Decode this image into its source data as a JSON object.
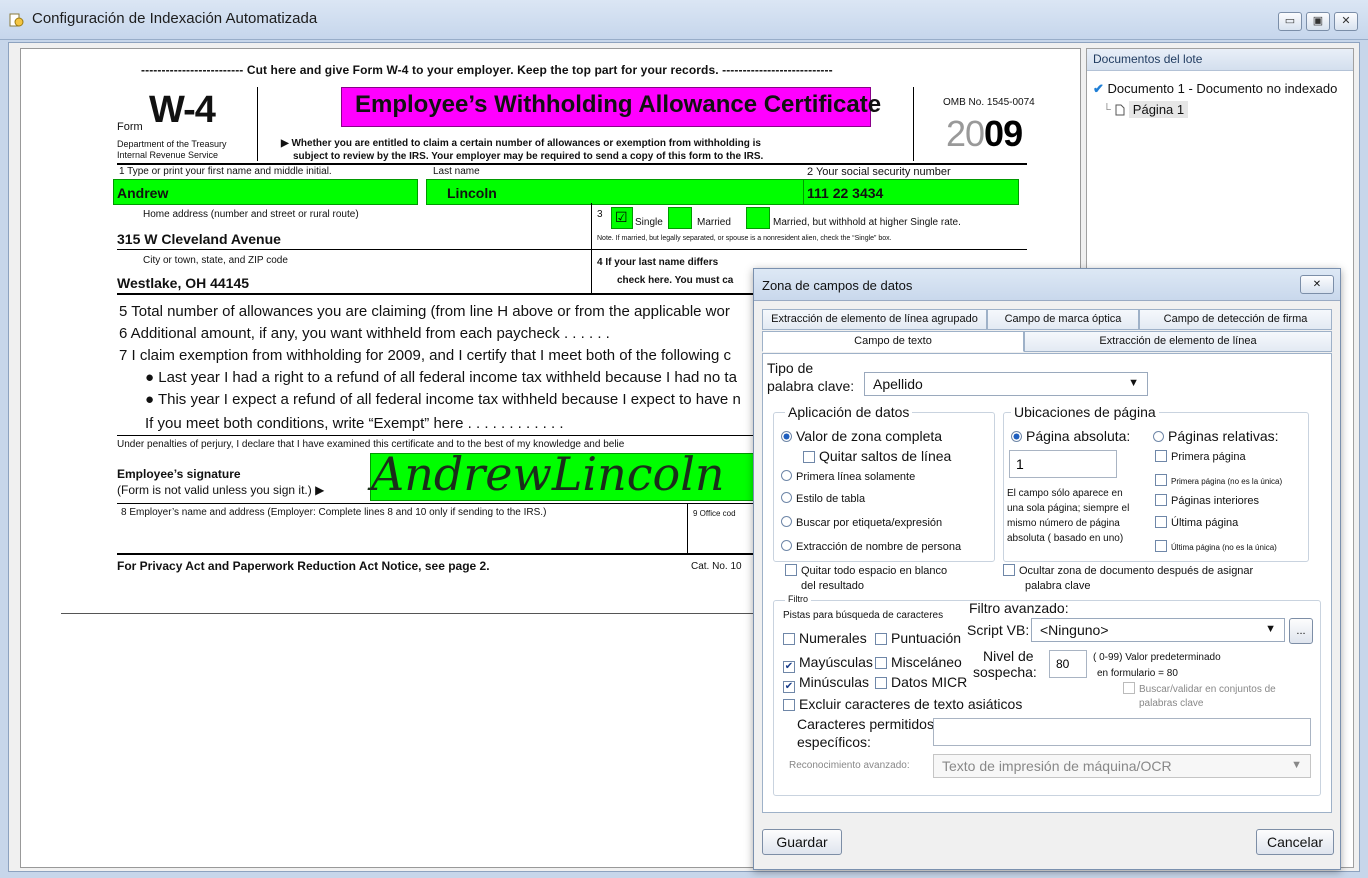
{
  "window": {
    "title": "Configuración de Indexación Automatizada",
    "min_glyph": "▭",
    "max_glyph": "▣",
    "close_glyph": "✕"
  },
  "form": {
    "cut_line": "-------------------------  Cut here and give Form W-4 to your employer. Keep the top part for your records.  ---------------------------",
    "form_word": "Form",
    "form_name": "W-4",
    "dept1": "Department of the Treasury",
    "dept2": "Internal Revenue Service",
    "title": "Employee’s Withholding Allowance Certificate",
    "sub1": "▶ Whether you are entitled to claim a certain number of allowances or exemption from withholding is",
    "sub2": "subject to review by the IRS. Your employer may be required to send a copy of this form to the IRS.",
    "omb": "OMB No. 1545-0074",
    "year_light": "20",
    "year_bold": "09",
    "f1_label": "1    Type or print your first name and middle initial.",
    "last_name_label": "Last name",
    "ssn_label": "2   Your social security number",
    "first_name": "Andrew",
    "last_name": "Lincoln",
    "ssn": "111  22  3434",
    "home_label": "Home address (number and street or rural route)",
    "home_value": "315 W Cleveland Avenue",
    "line3_num": "3",
    "single": "Single",
    "married": "Married",
    "married_higher": "Married, but withhold at higher Single rate.",
    "note": "Note. If married, but legally separated, or spouse is a nonresident alien, check the “Single” box.",
    "city_label": "City or town, state, and ZIP code",
    "city_value": "Westlake, OH 44145",
    "line4a": "4   If your last name differs",
    "line4b": "check here. You must ca",
    "l5": "5    Total number of allowances you are claiming (from line H above or from the applicable wor",
    "l6": "6    Additional amount, if any, you want withheld from each paycheck    .    .    .    .    .    .",
    "l7": "7    I claim exemption from withholding for 2009, and I certify that I meet both of the following c",
    "l7a": "● Last year I had a right to a refund of all federal income tax withheld because I had no ta",
    "l7b": "● This year I expect a refund of all federal income tax withheld because I expect to have n",
    "l7c": "If you meet both conditions, write “Exempt” here  .   .   .   .   .   .   .   .   .   .   .   .",
    "perjury": "Under penalties of perjury, I declare that I have examined this certificate and to the best of my knowledge and belie",
    "emp_sig": "Employee’s signature",
    "emp_sig2": "(Form is not valid unless you sign it.) ▶",
    "signature": "AndrewLincoln",
    "l8": "8    Employer’s name and address (Employer: Complete lines 8 and 10 only if sending to the IRS.)",
    "l9": "9  Office cod",
    "privacy": "For Privacy Act and Paperwork Reduction Act Notice, see page 2.",
    "cat": "Cat. No. 10"
  },
  "panel": {
    "header": "Documentos del lote",
    "doc_item": "Documento 1 - Documento no indexado",
    "page_item": "Página 1"
  },
  "dialog": {
    "title": "Zona de campos de datos",
    "close_glyph": "✕",
    "tabs": {
      "t1": "Extracción de elemento de línea agrupado",
      "t2": "Campo de marca óptica",
      "t3": "Campo de detección de firma",
      "t4": "Campo de texto",
      "t5": "Extracción de elemento de línea"
    },
    "keyword_type_label1": "Tipo de",
    "keyword_type_label2": "palabra clave:",
    "keyword_type_value": "Apellido",
    "app_group": "Aplicación de datos",
    "opt_full": "Valor de zona completa",
    "opt_strip": "Quitar saltos de línea",
    "opt_first": "Primera línea solamente",
    "opt_table": "Estilo de tabla",
    "opt_search": "Buscar por etiqueta/expresión",
    "opt_person": "Extracción de nombre de persona",
    "page_group": "Ubicaciones de página",
    "opt_abs": "Página absoluta:",
    "opt_rel": "Páginas relativas:",
    "abs_value": "1",
    "abs_note1": "El campo sólo aparece en",
    "abs_note2": "una sola página; siempre el",
    "abs_note3": "mismo número de página",
    "abs_note4": "absoluta ( basado en uno)",
    "rel_first": "Primera página",
    "rel_first_only": "Primera página   (no es la única)",
    "rel_inner": "Páginas interiores",
    "rel_last": "Última página",
    "rel_last_only": "Última página   (no es la única)",
    "trim1": "Quitar todo espacio en blanco",
    "trim2": "del resultado",
    "hide1": "Ocultar zona de documento después de asignar",
    "hide2": "palabra clave",
    "filter_group": "Filtro",
    "char_hints": "Pistas para búsqueda de caracteres",
    "numerals": "Numerales",
    "punct": "Puntuación",
    "upper": "Mayúsculas",
    "misc": "Misceláneo",
    "lower": "Minúsculas",
    "micr": "Datos MICR",
    "exclude_asian": "Excluir caracteres de texto asiáticos",
    "adv_filter": "Filtro avanzado:",
    "script_label": "Script VB:",
    "script_value": "<Ninguno>",
    "ellipsis": "...",
    "susp1": "Nivel de",
    "susp2": "sospecha:",
    "susp_value": "80",
    "susp_note1": "( 0-99)  Valor predeterminado",
    "susp_note2": "en formulario = 80",
    "validate1": "Buscar/validar en conjuntos de",
    "validate2": "palabras clave",
    "allowed1": "Caracteres permitidos",
    "allowed2": "específicos:",
    "allowed_value": "",
    "adv_recog_label": "Reconocimiento avanzado:",
    "adv_recog_value": "Texto de impresión de máquina/OCR",
    "save": "Guardar",
    "cancel": "Cancelar"
  }
}
